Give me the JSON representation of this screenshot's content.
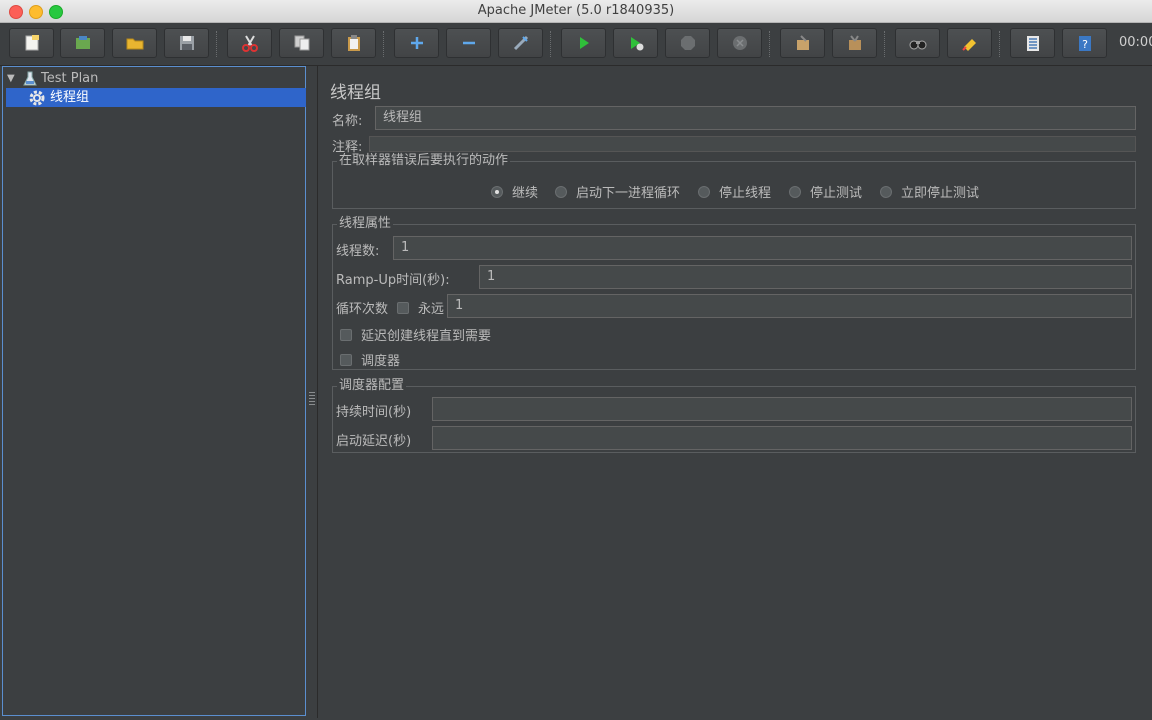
{
  "window": {
    "title": "Apache JMeter (5.0 r1840935)"
  },
  "toolbar": {
    "buttons": [
      {
        "name": "new",
        "icon": "new-file-icon"
      },
      {
        "name": "templates",
        "icon": "templates-icon"
      },
      {
        "name": "open",
        "icon": "folder-icon"
      },
      {
        "name": "save",
        "icon": "floppy-icon"
      },
      {
        "name": "cut",
        "icon": "scissors-icon"
      },
      {
        "name": "copy",
        "icon": "copy-icon"
      },
      {
        "name": "paste",
        "icon": "clipboard-icon"
      },
      {
        "name": "expand",
        "icon": "plus-icon"
      },
      {
        "name": "collapse",
        "icon": "minus-icon"
      },
      {
        "name": "toggle",
        "icon": "wand-icon"
      },
      {
        "name": "start",
        "icon": "play-icon"
      },
      {
        "name": "start-no-pause",
        "icon": "play-timer-icon"
      },
      {
        "name": "stop",
        "icon": "stop-icon"
      },
      {
        "name": "shutdown",
        "icon": "shutdown-icon"
      },
      {
        "name": "clear",
        "icon": "broom-icon"
      },
      {
        "name": "clear-all",
        "icon": "broom-all-icon"
      },
      {
        "name": "search",
        "icon": "binoculars-icon"
      },
      {
        "name": "reset-search",
        "icon": "reset-search-icon"
      },
      {
        "name": "function-helper",
        "icon": "list-icon"
      },
      {
        "name": "help",
        "icon": "help-icon"
      }
    ],
    "timer": "00:00"
  },
  "tree": {
    "root": {
      "label": "Test Plan",
      "icon": "test-plan-icon"
    },
    "child": {
      "label": "线程组",
      "icon": "gear-icon"
    }
  },
  "form": {
    "title": "线程组",
    "name_label": "名称:",
    "name_value": "线程组",
    "comment_label": "注释:",
    "comment_value": "",
    "error_group": {
      "title": "在取样器错误后要执行的动作",
      "options": [
        "继续",
        "启动下一进程循环",
        "停止线程",
        "停止测试",
        "立即停止测试"
      ],
      "selected": "继续"
    },
    "thread_group": {
      "title": "线程属性",
      "threads_label": "线程数:",
      "threads_value": "1",
      "rampup_label": "Ramp-Up时间(秒):",
      "rampup_value": "1",
      "loop_label": "循环次数",
      "forever_label": "永远",
      "forever_checked": false,
      "loop_value": "1",
      "delay_label": "延迟创建线程直到需要",
      "delay_checked": false,
      "scheduler_label": "调度器",
      "scheduler_checked": false
    },
    "scheduler_group": {
      "title": "调度器配置",
      "duration_label": "持续时间(秒)",
      "duration_value": "",
      "delay_label": "启动延迟(秒)",
      "delay_value": ""
    }
  }
}
